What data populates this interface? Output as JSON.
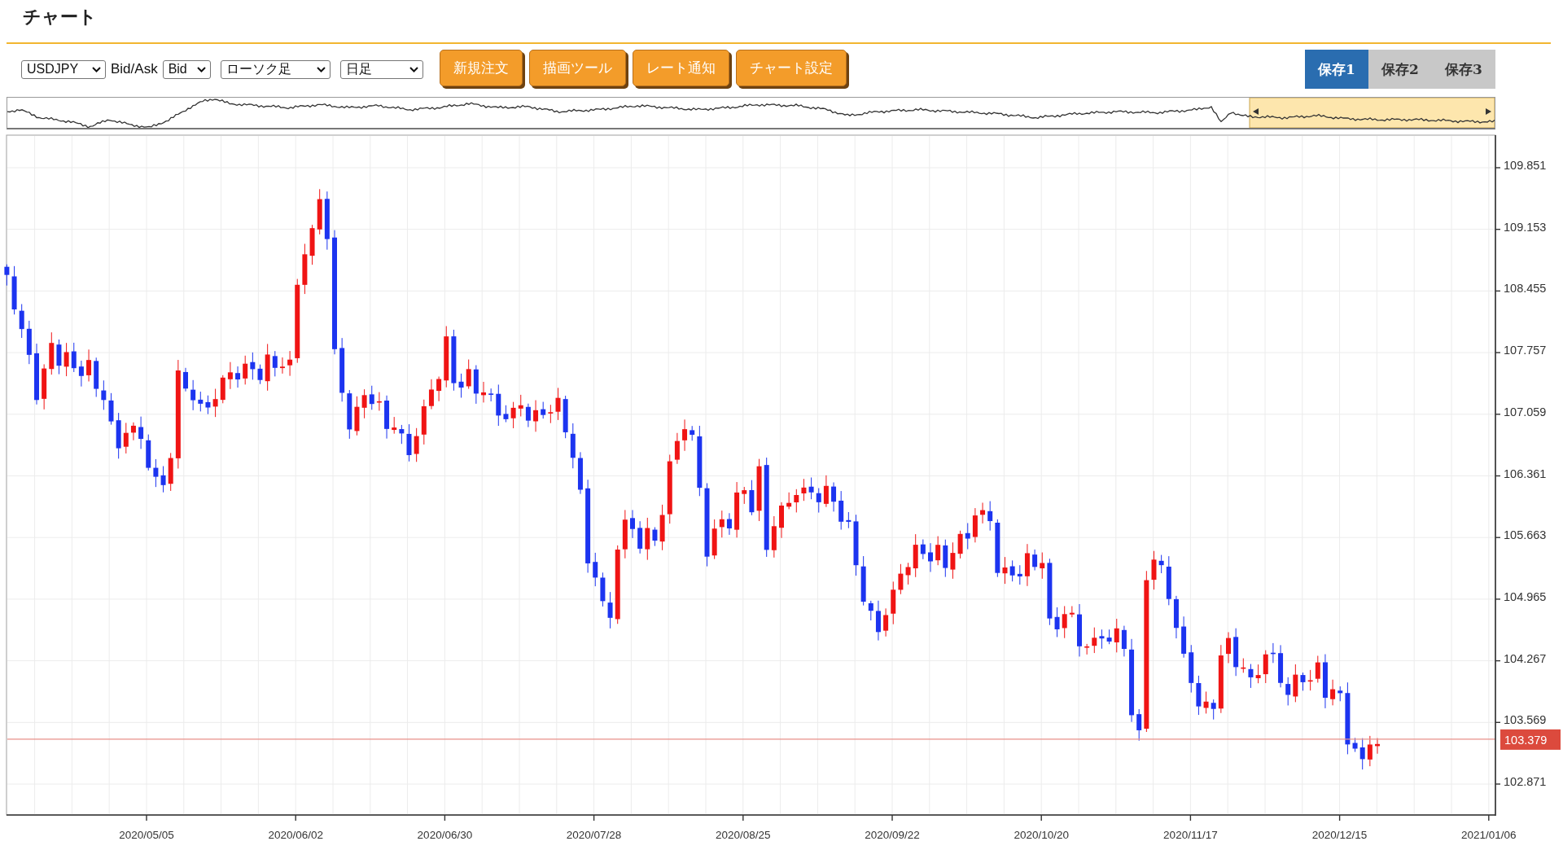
{
  "header": {
    "title": "チャート"
  },
  "toolbar": {
    "symbol": {
      "value": "USDJPY"
    },
    "price_side": {
      "label": "Bid/Ask",
      "value": "Bid"
    },
    "chart_type": {
      "value": "ローソク足"
    },
    "timeframe": {
      "value": "日足"
    },
    "buttons": [
      "新規注文",
      "描画ツール",
      "レート通知",
      "チャート設定"
    ],
    "save_slots": [
      {
        "label": "保存1",
        "selected": true
      },
      {
        "label": "保存2",
        "selected": false
      },
      {
        "label": "保存3",
        "selected": false
      }
    ]
  },
  "chart": {
    "y_ticks": [
      "109.851",
      "109.153",
      "108.455",
      "107.757",
      "107.059",
      "106.361",
      "105.663",
      "104.965",
      "104.267",
      "103.569",
      "102.871"
    ],
    "x_ticks": [
      "2020/05/05",
      "2020/06/02",
      "2020/06/30",
      "2020/07/28",
      "2020/08/25",
      "2020/09/22",
      "2020/10/20",
      "2020/11/17",
      "2020/12/15",
      "2021/01/06"
    ],
    "current_price": "103.379"
  }
}
